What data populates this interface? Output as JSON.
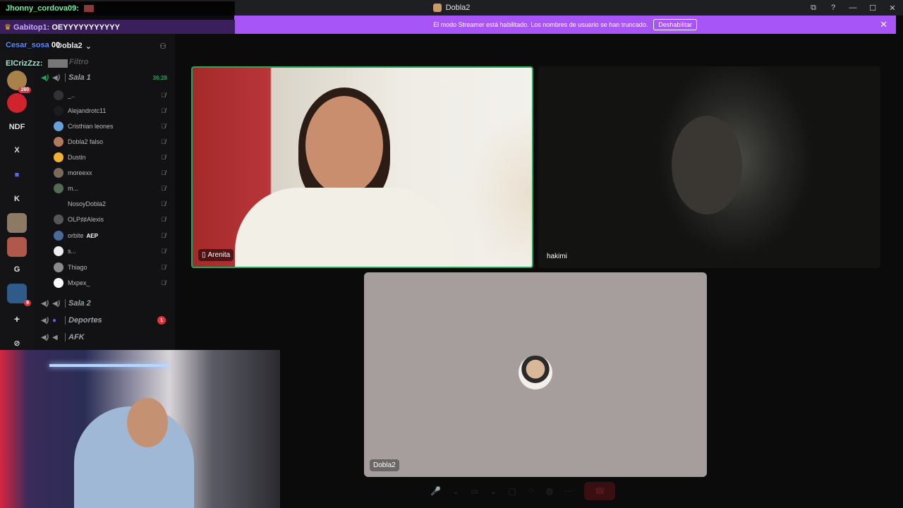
{
  "window": {
    "title": "Dobla2",
    "controls": [
      "⧉",
      "?",
      "—",
      "☐",
      "✕"
    ]
  },
  "banner": {
    "message": "El modo Streamer está habilitado. Los nombres de usuario se han truncado.",
    "button_label": "Deshabilitar",
    "close_glyph": "✕",
    "color": "#a855f7"
  },
  "chat": [
    {
      "user": "Jhonny_cordova09:",
      "message": ""
    },
    {
      "user": "Gabitop1:",
      "message": "OEYYYYYYYYYYY"
    },
    {
      "user": "Cesar_sosa",
      "message": "00"
    },
    {
      "user": "ElCrizZzz:",
      "message": ""
    }
  ],
  "rail": {
    "items": [
      {
        "label": "",
        "icon": "server-icon",
        "badge": "260"
      },
      {
        "label": "",
        "icon": "spiderman-icon",
        "badge": ""
      },
      {
        "label": "NDF",
        "icon": "",
        "badge": ""
      },
      {
        "label": "X",
        "icon": "",
        "badge": ""
      },
      {
        "label": "",
        "icon": "folder-icon",
        "badge": ""
      },
      {
        "label": "K",
        "icon": "",
        "badge": ""
      },
      {
        "label": "",
        "icon": "server-icon",
        "badge": ""
      },
      {
        "label": "",
        "icon": "server-icon",
        "badge": ""
      },
      {
        "label": "G",
        "icon": "",
        "badge": ""
      },
      {
        "label": "",
        "icon": "server-icon",
        "badge": "9"
      },
      {
        "label": "+",
        "icon": "plus-icon",
        "badge": ""
      },
      {
        "label": "⊘",
        "icon": "compass-icon",
        "badge": ""
      }
    ]
  },
  "server": {
    "name": "Dobla2",
    "filter_label": "Filtro",
    "channels": [
      {
        "name": "Sala 1",
        "timer": "36:28",
        "unread": ""
      },
      {
        "name": "Sala 2",
        "timer": "",
        "unread": ""
      },
      {
        "name": "Deportes",
        "timer": "",
        "unread": "1"
      },
      {
        "name": "AFK",
        "timer": "",
        "unread": ""
      }
    ],
    "members": [
      {
        "name": "_..",
        "mic": "🎙̸",
        "tag": ""
      },
      {
        "name": "Alejandrotc11",
        "mic": "🎙̸",
        "tag": ""
      },
      {
        "name": "Cristhian leones",
        "mic": "🎙̸",
        "tag": ""
      },
      {
        "name": "Dobla2 falso",
        "mic": "🎙̸",
        "tag": ""
      },
      {
        "name": "Dustin",
        "mic": "🎙̸",
        "tag": ""
      },
      {
        "name": "moreexx",
        "mic": "🎙̸",
        "tag": ""
      },
      {
        "name": "m...",
        "mic": "🎙̸",
        "tag": ""
      },
      {
        "name": "NosoyDobla2",
        "mic": "🎙̸",
        "tag": ""
      },
      {
        "name": "OLP♯♯Alexis",
        "mic": "🎙̸",
        "tag": ""
      },
      {
        "name": "orbite",
        "mic": "🎙̸",
        "tag": "AEP"
      },
      {
        "name": "s...",
        "mic": "🎙̸",
        "tag": ""
      },
      {
        "name": "Thiago",
        "mic": "🎙̸",
        "tag": ""
      },
      {
        "name": "Mxpex_",
        "mic": "🎙̸",
        "tag": ""
      }
    ]
  },
  "call": {
    "tiles": [
      {
        "name": "Arenita",
        "speaking": true
      },
      {
        "name": "hakimi",
        "speaking": false
      },
      {
        "name": "Dobla2",
        "speaking": false
      }
    ],
    "controls": [
      "🎤",
      "⌄",
      "▭",
      "⌄",
      "▢",
      "⁘",
      "◍",
      "⋯"
    ],
    "end_call_glyph": "☎"
  },
  "colors": {
    "speaking_border": "#23a55a",
    "timer": "#23a55a",
    "badge": "#e0343a"
  }
}
